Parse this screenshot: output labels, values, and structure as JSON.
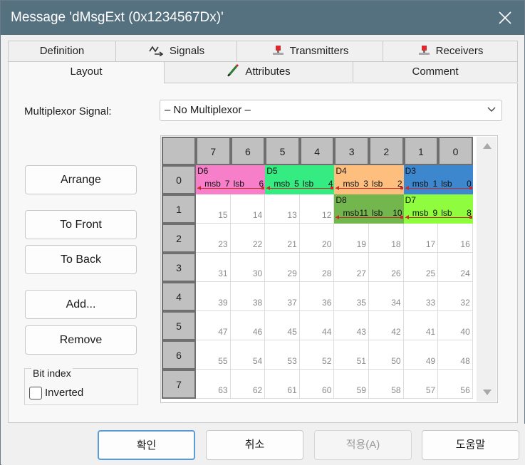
{
  "window": {
    "title": "Message 'dMsgExt (0x1234567Dx)'"
  },
  "tabs_row1": [
    {
      "label": "Definition",
      "icon": ""
    },
    {
      "label": "Signals",
      "icon": "signals-icon"
    },
    {
      "label": "Transmitters",
      "icon": "transmitter-icon"
    },
    {
      "label": "Receivers",
      "icon": "receiver-icon"
    }
  ],
  "tabs_row2": [
    {
      "label": "Layout",
      "icon": ""
    },
    {
      "label": "Attributes",
      "icon": "attributes-icon"
    },
    {
      "label": "Comment",
      "icon": ""
    }
  ],
  "active_tab": "Layout",
  "multiplexor": {
    "label": "Multiplexor Signal:",
    "value": "– No Multiplexor –"
  },
  "side_buttons": {
    "arrange": "Arrange",
    "to_front": "To Front",
    "to_back": "To Back",
    "add": "Add...",
    "remove": "Remove"
  },
  "bit_index": {
    "title": "Bit index",
    "inverted_label": "Inverted",
    "inverted_checked": false
  },
  "grid": {
    "column_headers": [
      "7",
      "6",
      "5",
      "4",
      "3",
      "2",
      "1",
      "0"
    ],
    "row_headers": [
      "0",
      "1",
      "2",
      "3",
      "4",
      "5",
      "6",
      "7"
    ],
    "signals": [
      {
        "name": "D6",
        "row": 0,
        "col_start": 0,
        "col_end": 1,
        "color": "#f77ec9",
        "msb_label": "msb",
        "msb_bit": "7",
        "lsb_label": "lsb",
        "lsb_bit": "6"
      },
      {
        "name": "D5",
        "row": 0,
        "col_start": 2,
        "col_end": 3,
        "color": "#35ec83",
        "msb_label": "msb",
        "msb_bit": "5",
        "lsb_label": "lsb",
        "lsb_bit": "4"
      },
      {
        "name": "D4",
        "row": 0,
        "col_start": 4,
        "col_end": 5,
        "color": "#fdbe7e",
        "msb_label": "msb",
        "msb_bit": "3",
        "lsb_label": "lsb",
        "lsb_bit": "2"
      },
      {
        "name": "D3",
        "row": 0,
        "col_start": 6,
        "col_end": 7,
        "color": "#3d87cf",
        "msb_label": "msb",
        "msb_bit": "1",
        "lsb_label": "lsb",
        "lsb_bit": "0"
      },
      {
        "name": "D8",
        "row": 1,
        "col_start": 4,
        "col_end": 5,
        "color": "#74b64e",
        "msb_label": "msb",
        "msb_bit": "11",
        "lsb_label": "lsb",
        "lsb_bit": "10"
      },
      {
        "name": "D7",
        "row": 1,
        "col_start": 6,
        "col_end": 7,
        "color": "#8ffd3e",
        "msb_label": "msb",
        "msb_bit": "9",
        "lsb_label": "lsb",
        "lsb_bit": "8"
      }
    ],
    "line_color": "#c92a2a"
  },
  "footer": {
    "ok": "확인",
    "cancel": "취소",
    "apply": "적용(A)",
    "help": "도움말"
  }
}
